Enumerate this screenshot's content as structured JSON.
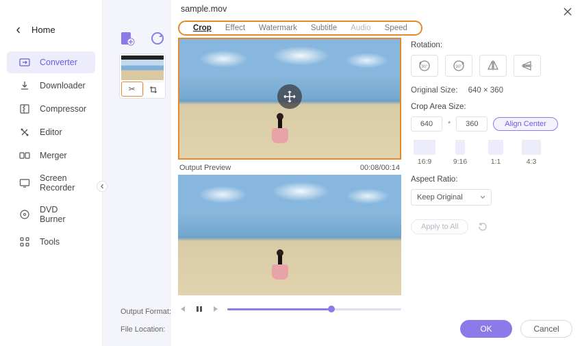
{
  "sidebar": {
    "home": "Home",
    "items": [
      {
        "label": "Converter",
        "icon": "converter-icon"
      },
      {
        "label": "Downloader",
        "icon": "downloader-icon"
      },
      {
        "label": "Compressor",
        "icon": "compressor-icon"
      },
      {
        "label": "Editor",
        "icon": "editor-icon"
      },
      {
        "label": "Merger",
        "icon": "merger-icon"
      },
      {
        "label": "Screen Recorder",
        "icon": "screen-recorder-icon"
      },
      {
        "label": "DVD Burner",
        "icon": "dvd-burner-icon"
      },
      {
        "label": "Tools",
        "icon": "tools-icon"
      }
    ]
  },
  "bottom": {
    "output_format": "Output Format:",
    "file_location": "File Location:"
  },
  "modal": {
    "title": "sample.mov",
    "tabs": [
      "Crop",
      "Effect",
      "Watermark",
      "Subtitle",
      "Audio",
      "Speed"
    ],
    "preview": {
      "output_label": "Output Preview",
      "time": "00:08/00:14"
    },
    "rotation_label": "Rotation:",
    "original_size_label": "Original Size:",
    "original_size_value": "640 × 360",
    "crop_area_label": "Crop Area Size:",
    "crop_w": "640",
    "crop_star": "*",
    "crop_h": "360",
    "align_center": "Align Center",
    "ratios": [
      {
        "label": "16:9"
      },
      {
        "label": "9:16"
      },
      {
        "label": "1:1"
      },
      {
        "label": "4:3"
      }
    ],
    "aspect_ratio_label": "Aspect Ratio:",
    "aspect_ratio_value": "Keep Original",
    "apply_to_all": "Apply to All",
    "ok": "OK",
    "cancel": "Cancel"
  },
  "colors": {
    "accent": "#8B7BE8",
    "highlight": "#E68A2E"
  }
}
